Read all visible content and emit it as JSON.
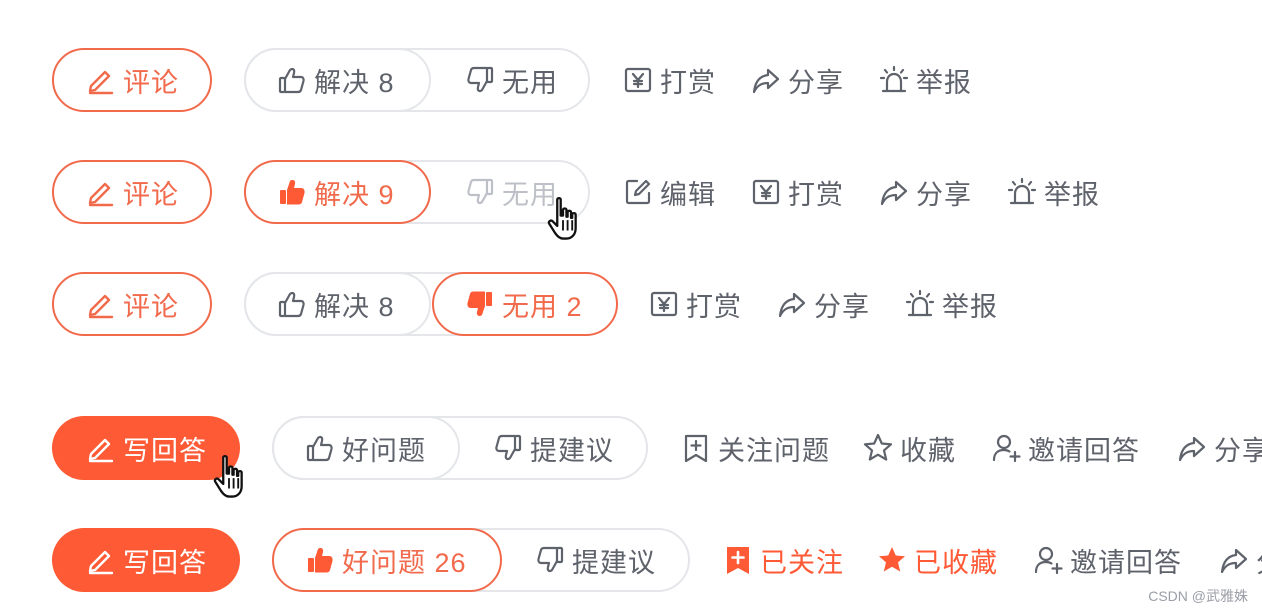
{
  "rows": [
    {
      "comment": "评论",
      "solve": "解决 8",
      "useless": "无用",
      "actions": [
        "打赏",
        "分享",
        "举报"
      ]
    },
    {
      "comment": "评论",
      "solve": "解决 9",
      "useless": "无用",
      "actions": [
        "编辑",
        "打赏",
        "分享",
        "举报"
      ]
    },
    {
      "comment": "评论",
      "solve": "解决 8",
      "useless": "无用 2",
      "actions": [
        "打赏",
        "分享",
        "举报"
      ]
    },
    {
      "write": "写回答",
      "good": "好问题",
      "suggest": "提建议",
      "actions": [
        "关注问题",
        "收藏",
        "邀请回答",
        "分享"
      ]
    },
    {
      "write": "写回答",
      "good": "好问题 26",
      "suggest": "提建议",
      "actions": [
        "已关注",
        "已收藏",
        "邀请回答",
        "分享"
      ]
    }
  ],
  "watermark": "CSDN @武雅姝",
  "colors": {
    "accent": "#ff5a36",
    "outline": "#f26a4c",
    "text": "#5e626b",
    "border": "#e4e6ea"
  },
  "icons": [
    "pencil-icon",
    "thumbs-up-icon",
    "thumbs-down-icon",
    "reward-icon",
    "share-icon",
    "alarm-icon",
    "edit-icon",
    "plus-box-icon",
    "star-icon",
    "user-add-icon",
    "pointer-cursor-icon"
  ]
}
